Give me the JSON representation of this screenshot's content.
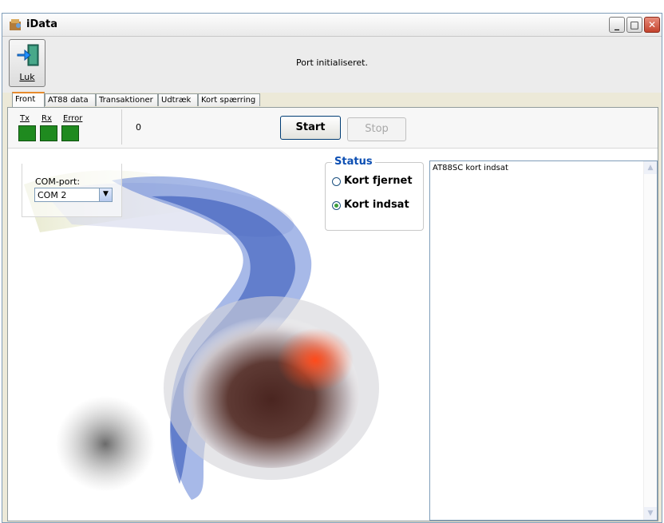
{
  "window": {
    "title": "iData"
  },
  "toolbar": {
    "luk_label": "Luk",
    "port_status": "Port initialiseret."
  },
  "tabs": [
    "Front",
    "AT88 data",
    "Transaktioner",
    "Udtræk",
    "Kort spærring"
  ],
  "indicators": {
    "tx": "Tx",
    "rx": "Rx",
    "error": "Error"
  },
  "counter": "0",
  "buttons": {
    "start": "Start",
    "stop": "Stop"
  },
  "comport": {
    "label": "COM-port:",
    "value": "COM 2"
  },
  "status": {
    "legend": "Status",
    "options": [
      "Kort fjernet",
      "Kort indsat"
    ],
    "selected": "Kort indsat"
  },
  "log": {
    "lines": [
      "AT88SC kort indsat"
    ]
  },
  "colors": {
    "led": "#1f8a1f",
    "status_legend": "#0d4fb3",
    "close_button": "#c4432d"
  }
}
